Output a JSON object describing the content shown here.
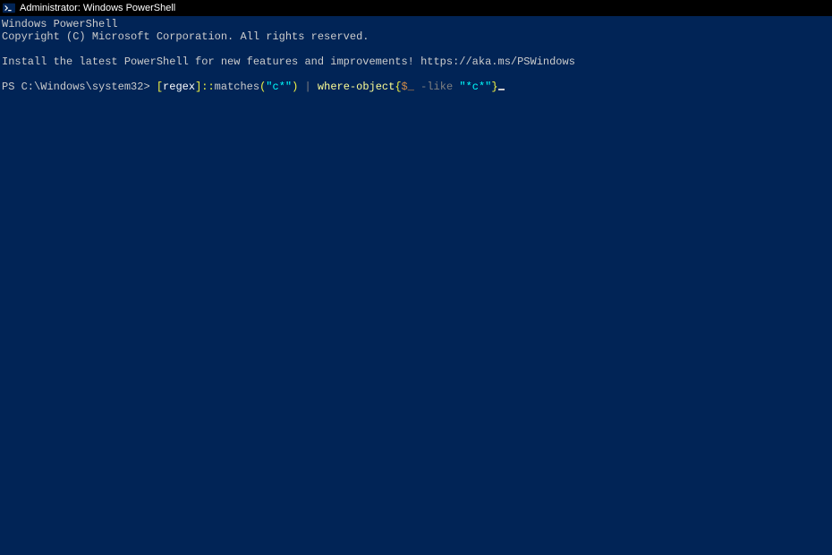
{
  "titlebar": {
    "icon_name": "powershell-icon",
    "title": "Administrator: Windows PowerShell"
  },
  "terminal": {
    "banner_line_1": "Windows PowerShell",
    "banner_line_2": "Copyright (C) Microsoft Corporation. All rights reserved.",
    "install_hint": "Install the latest PowerShell for new features and improvements! https://aka.ms/PSWindows",
    "prompt": {
      "ps": "PS ",
      "path": "C:\\Windows\\system32",
      "gt": "> ",
      "tokens": {
        "regex_open": "[",
        "regex_name": "regex",
        "regex_close": "]::",
        "method": "matches",
        "paren_open": "(",
        "str1": "\"c*\"",
        "paren_close": ") ",
        "pipe": "|",
        "space1": " ",
        "cmdlet": "where-object",
        "brace_open": "{",
        "var": "$_",
        "op": " -like ",
        "str2": "\"*c*\"",
        "brace_close": "}"
      }
    }
  },
  "colors": {
    "terminal_bg": "#012456",
    "default_text": "#cccccc",
    "yellow": "#f5f543",
    "white": "#ffffff",
    "gray": "#808080",
    "cmdlet": "#ffff96",
    "cyan": "#00ffff",
    "orange": "#d18b47"
  }
}
